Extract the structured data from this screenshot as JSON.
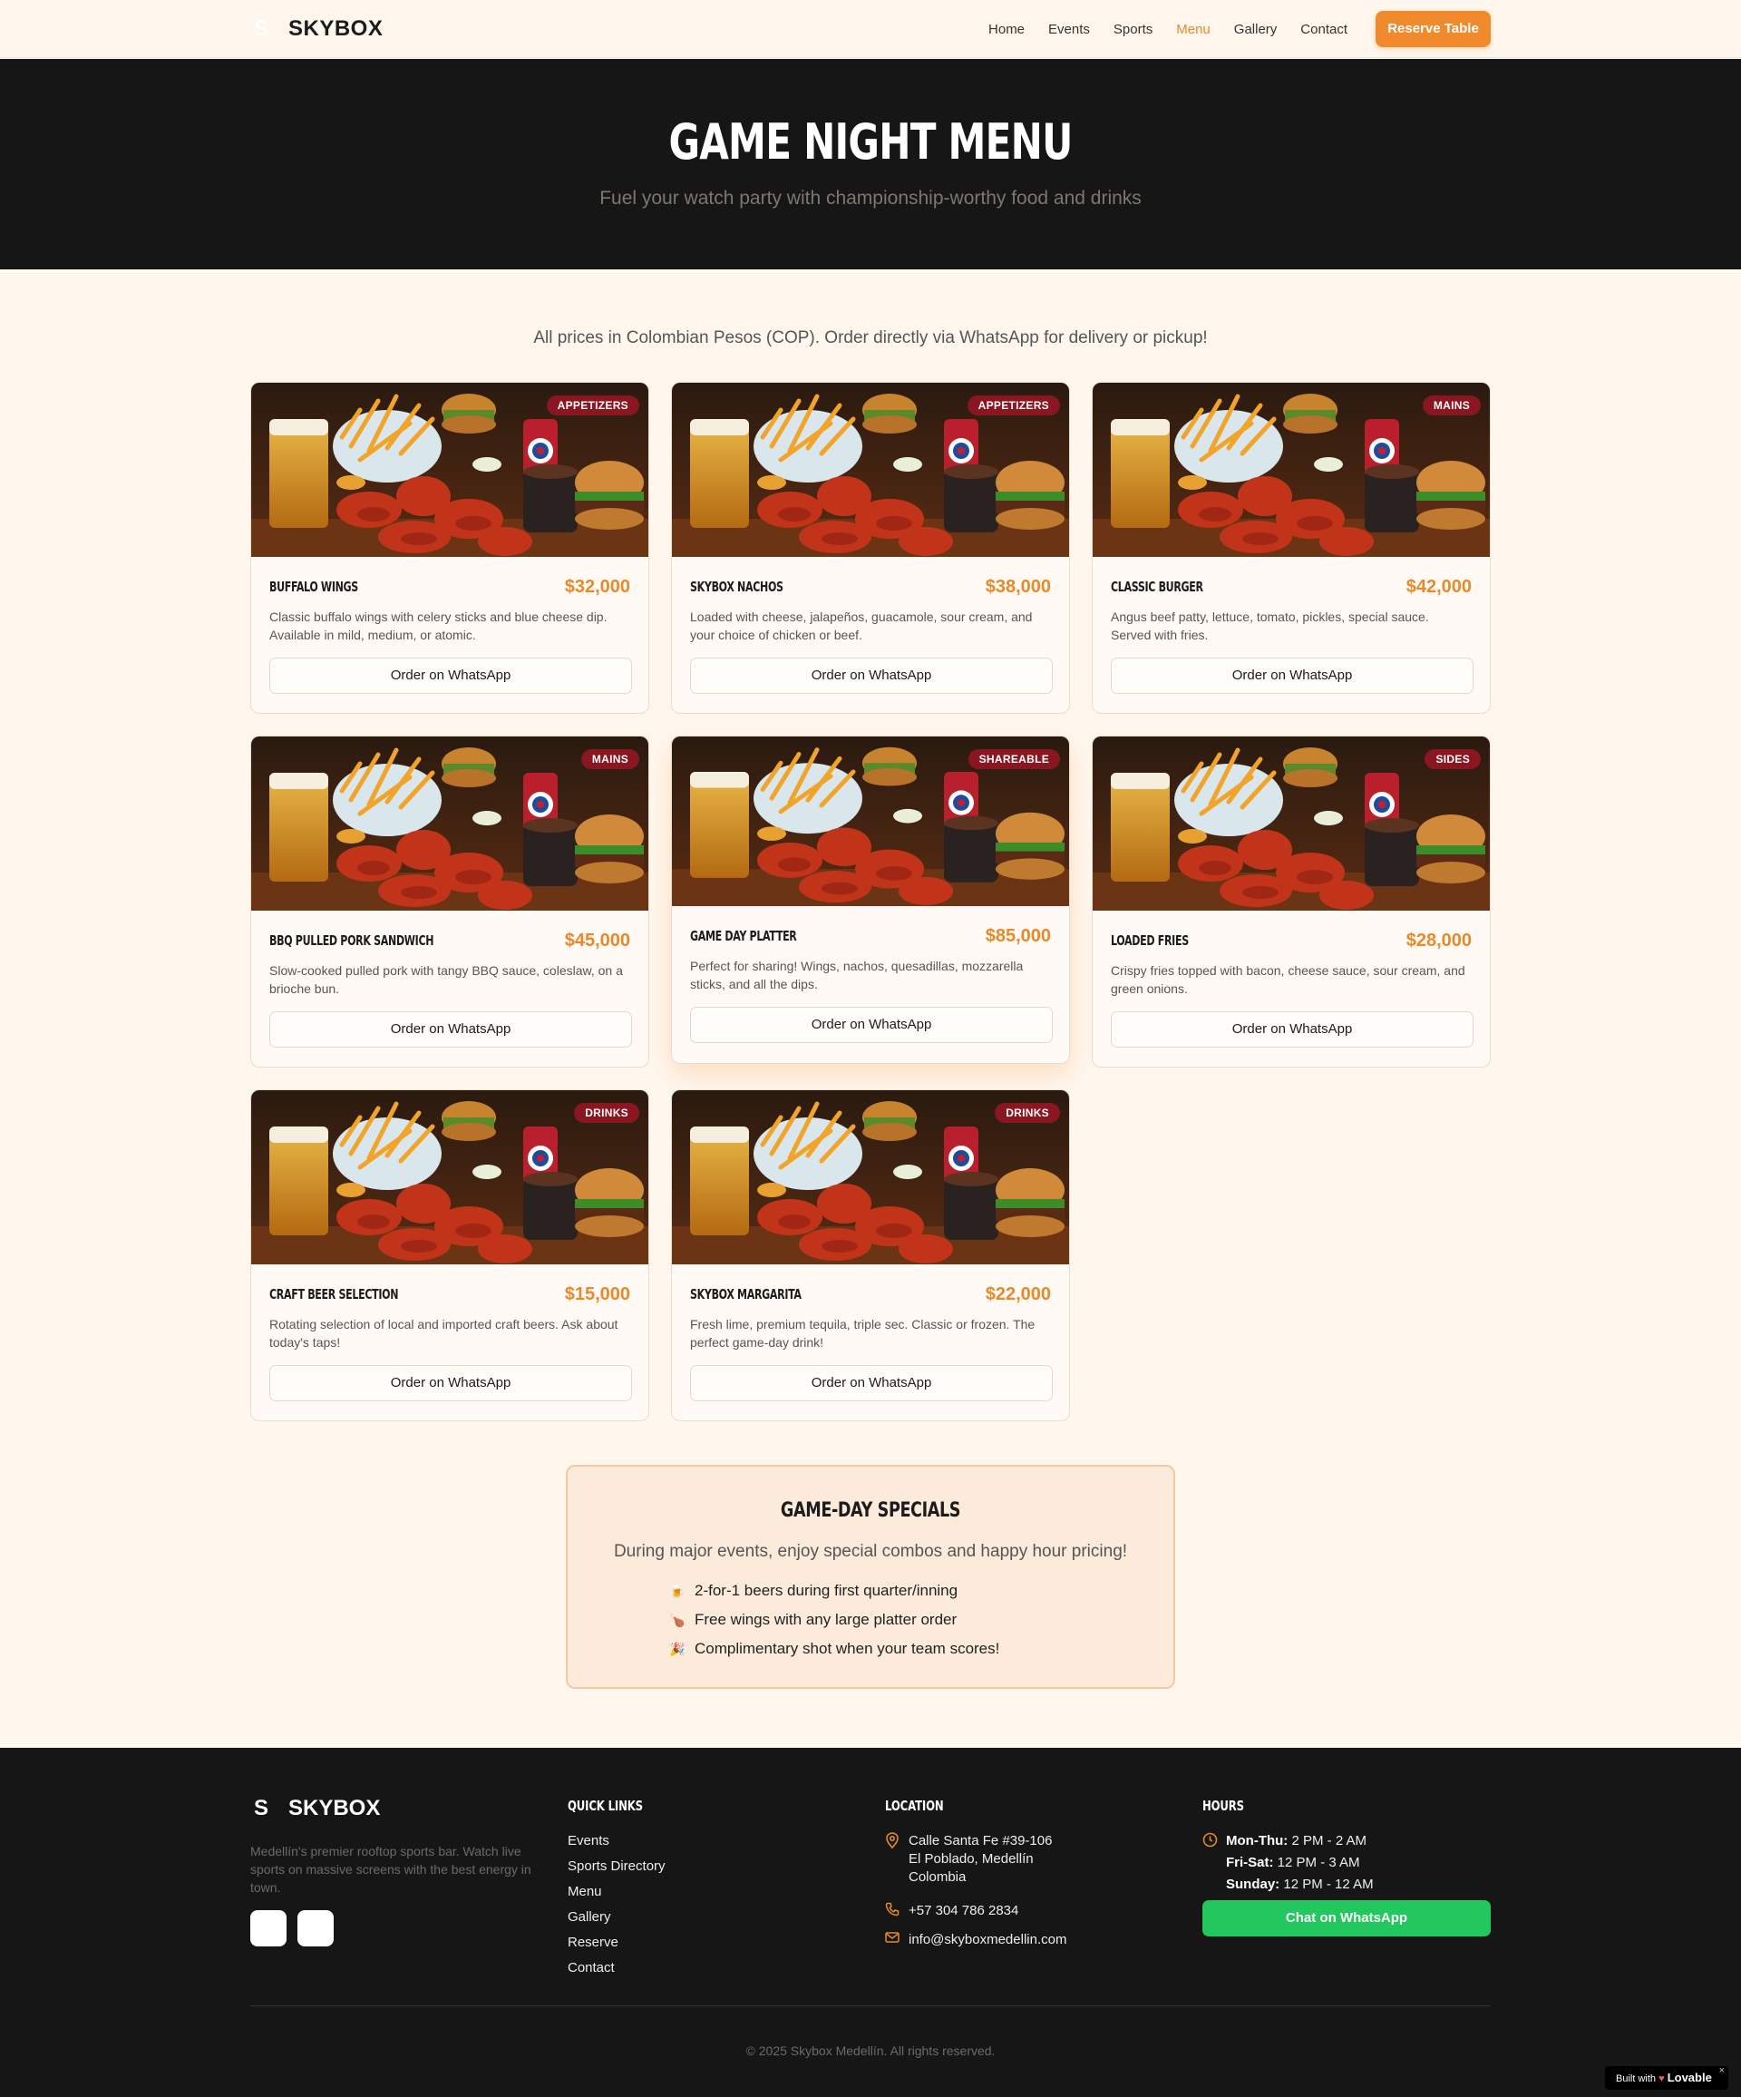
{
  "nav": {
    "brand_mark": "S",
    "brand_name": "SKYBOX",
    "links": [
      "Home",
      "Events",
      "Sports",
      "Menu",
      "Gallery",
      "Contact"
    ],
    "active": "Menu",
    "reserve_label": "Reserve Table"
  },
  "hero": {
    "title": "GAME NIGHT MENU",
    "subtitle": "Fuel your watch party with championship-worthy food and drinks"
  },
  "note": "All prices in Colombian Pesos (COP). Order directly via WhatsApp for delivery or pickup!",
  "menu": [
    {
      "category": "APPETIZERS",
      "name": "BUFFALO WINGS",
      "price": "$32,000",
      "desc": "Classic buffalo wings with celery sticks and blue cheese dip. Available in mild, medium, or atomic.",
      "cta": "Order on WhatsApp"
    },
    {
      "category": "APPETIZERS",
      "name": "SKYBOX NACHOS",
      "price": "$38,000",
      "desc": "Loaded with cheese, jalapeños, guacamole, sour cream, and your choice of chicken or beef.",
      "cta": "Order on WhatsApp"
    },
    {
      "category": "MAINS",
      "name": "CLASSIC BURGER",
      "price": "$42,000",
      "desc": "Angus beef patty, lettuce, tomato, pickles, special sauce. Served with fries.",
      "cta": "Order on WhatsApp"
    },
    {
      "category": "MAINS",
      "name": "BBQ PULLED PORK SANDWICH",
      "price": "$45,000",
      "desc": "Slow-cooked pulled pork with tangy BBQ sauce, coleslaw, on a brioche bun.",
      "cta": "Order on WhatsApp"
    },
    {
      "category": "SHAREABLE",
      "name": "GAME DAY PLATTER",
      "price": "$85,000",
      "desc": "Perfect for sharing! Wings, nachos, quesadillas, mozzarella sticks, and all the dips.",
      "cta": "Order on WhatsApp"
    },
    {
      "category": "SIDES",
      "name": "LOADED FRIES",
      "price": "$28,000",
      "desc": "Crispy fries topped with bacon, cheese sauce, sour cream, and green onions.",
      "cta": "Order on WhatsApp"
    },
    {
      "category": "DRINKS",
      "name": "CRAFT BEER SELECTION",
      "price": "$15,000",
      "desc": "Rotating selection of local and imported craft beers. Ask about today's taps!",
      "cta": "Order on WhatsApp"
    },
    {
      "category": "DRINKS",
      "name": "SKYBOX MARGARITA",
      "price": "$22,000",
      "desc": "Fresh lime, premium tequila, triple sec. Classic or frozen. The perfect game-day drink!",
      "cta": "Order on WhatsApp"
    }
  ],
  "specials": {
    "title": "GAME-DAY SPECIALS",
    "subtitle": "During major events, enjoy special combos and happy hour pricing!",
    "items": [
      {
        "emoji": "🍺",
        "text": "2-for-1 beers during first quarter/inning"
      },
      {
        "emoji": "🍗",
        "text": "Free wings with any large platter order"
      },
      {
        "emoji": "🎉",
        "text": "Complimentary shot when your team scores!"
      }
    ]
  },
  "footer": {
    "brand_mark": "S",
    "brand_name": "SKYBOX",
    "description": "Medellín's premier rooftop sports bar. Watch live sports on massive screens with the best energy in town.",
    "quick_links_title": "QUICK LINKS",
    "quick_links": [
      "Events",
      "Sports Directory",
      "Menu",
      "Gallery",
      "Reserve",
      "Contact"
    ],
    "location_title": "LOCATION",
    "address": "Calle Santa Fe #39-106 El Poblado, Medellín Colombia",
    "phone": "+57 304 786 2834",
    "email": "info@skyboxmedellin.com",
    "hours_title": "HOURS",
    "hours": [
      {
        "day": "Mon-Thu:",
        "time": "2 PM - 2 AM"
      },
      {
        "day": "Fri-Sat:",
        "time": "12 PM - 3 AM"
      },
      {
        "day": "Sunday:",
        "time": "12 PM - 12 AM"
      }
    ],
    "whatsapp_label": "Chat on WhatsApp",
    "copyright": "© 2025 Skybox Medellín. All rights reserved."
  },
  "badge": {
    "prefix": "Built with",
    "brand": "Lovable",
    "close": "×"
  },
  "colors": {
    "accent": "#f08a2c",
    "badge": "#8a1622",
    "whatsapp": "#22c85e",
    "dark": "#161616"
  },
  "icons": [
    "map-pin-icon",
    "phone-icon",
    "mail-icon",
    "clock-icon"
  ]
}
